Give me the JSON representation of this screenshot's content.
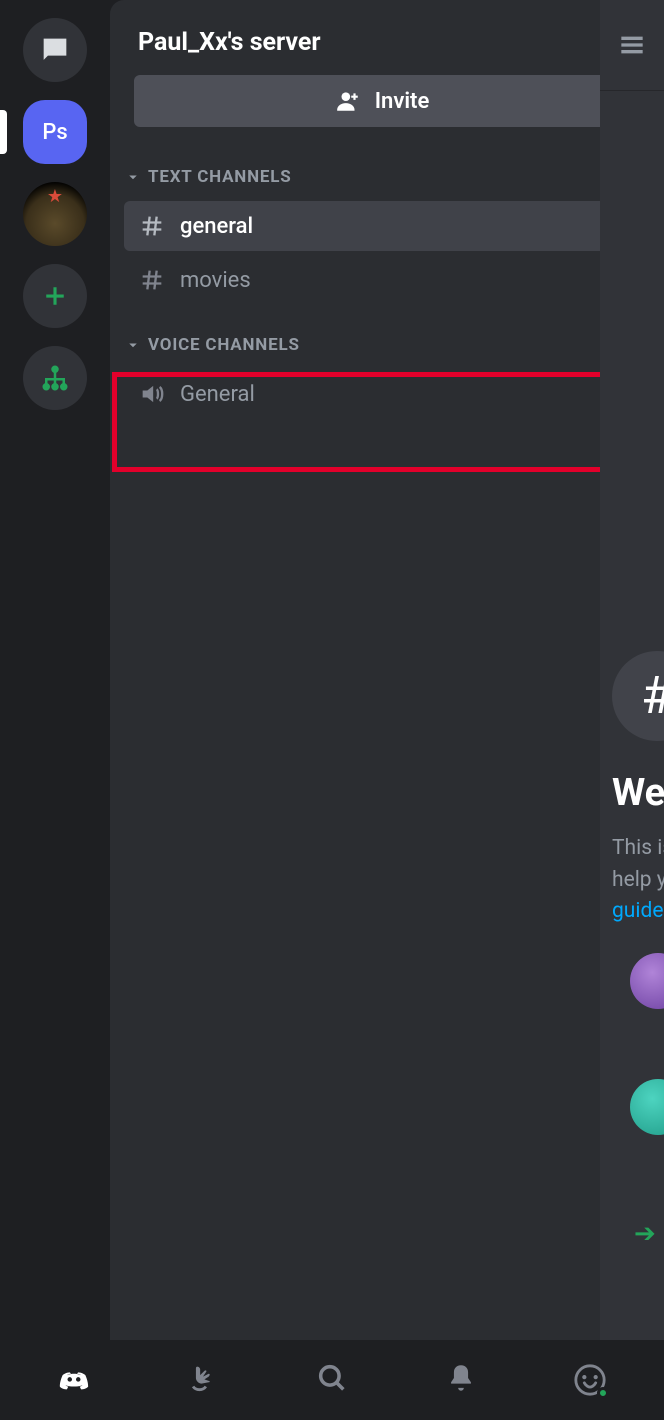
{
  "server": {
    "title": "Paul_Xx's server",
    "invite_label": "Invite"
  },
  "rail": {
    "selected_label": "Ps"
  },
  "categories": {
    "text": {
      "label": "TEXT CHANNELS",
      "channels": [
        {
          "name": "general",
          "active": true
        },
        {
          "name": "movies",
          "active": false
        }
      ]
    },
    "voice": {
      "label": "VOICE CHANNELS",
      "channels": [
        {
          "name": "General"
        }
      ]
    }
  },
  "peek": {
    "heading": "Wel",
    "line1": "This is",
    "line2": "help y",
    "link": "guide"
  }
}
